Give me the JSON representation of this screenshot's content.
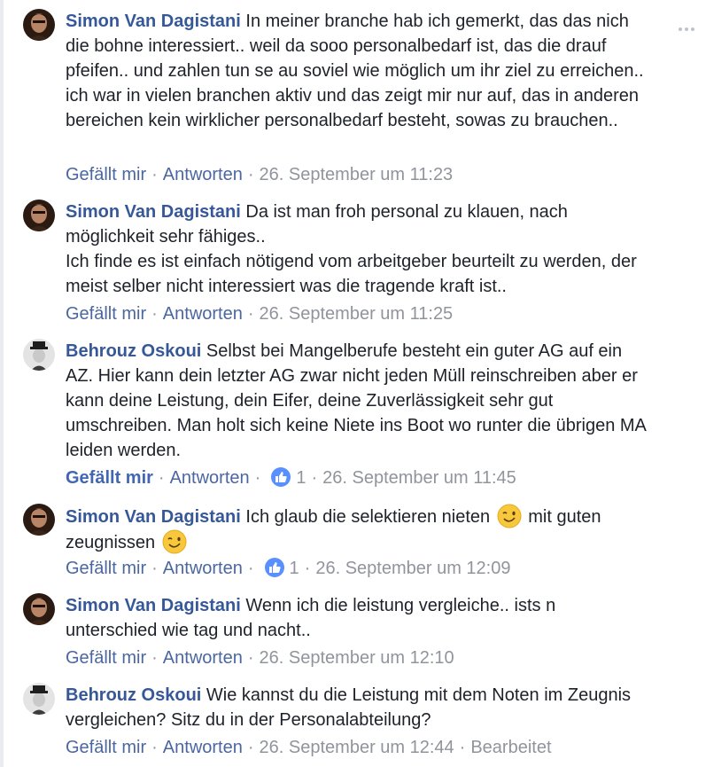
{
  "comments": [
    {
      "author": "Simon Van Dagistani",
      "avatar_type": "simon",
      "text": "In meiner branche hab ich gemerkt, das das nich die bohne interessiert.. weil da sooo personalbedarf ist, das die drauf pfeifen.. und zahlen tun se au soviel wie möglich um ihr ziel zu erreichen.. ich war in vielen branchen aktiv und das zeigt mir nur auf, das in anderen bereichen kein wirklicher personalbedarf besteht, sowas zu brauchen..",
      "like_label": "Gefällt mir",
      "reply_label": "Antworten",
      "time": "26. September um 11:23"
    },
    {
      "author": "Simon Van Dagistani",
      "avatar_type": "simon",
      "text_lines": [
        "Da ist man froh personal zu klauen, nach möglichkeit sehr fähiges..",
        "Ich finde es ist einfach nötigend vom arbeitgeber beurteilt zu werden, der meist selber nicht interessiert was die tragende kraft ist.."
      ],
      "like_label": "Gefällt mir",
      "reply_label": "Antworten",
      "time": "26. September um 11:25"
    },
    {
      "author": "Behrouz Oskoui",
      "avatar_type": "behrouz",
      "text": "Selbst bei Mangelberufe besteht ein guter AG auf ein AZ. Hier kann dein letzter AG zwar nicht jeden Müll reinschreiben aber er kann deine Leistung, dein Eifer, deine Zuverlässigkeit sehr gut umschreiben. Man holt sich keine Niete ins Boot wo runter die übrigen MA leiden werden.",
      "like_label": "Gefällt mir",
      "reply_label": "Antworten",
      "like_count": "1",
      "time": "26. September um 11:45"
    },
    {
      "author": "Simon Van Dagistani",
      "avatar_type": "simon",
      "text_a": "Ich glaub die selektieren nieten",
      "text_b": "mit guten zeugnissen",
      "emoji": "wink-emoji",
      "like_label": "Gefällt mir",
      "reply_label": "Antworten",
      "like_count": "1",
      "time": "26. September um 12:09"
    },
    {
      "author": "Simon Van Dagistani",
      "avatar_type": "simon",
      "text": "Wenn ich die leistung vergleiche.. ists n unterschied wie tag und nacht..",
      "like_label": "Gefällt mir",
      "reply_label": "Antworten",
      "time": "26. September um 12:10"
    },
    {
      "author": "Behrouz Oskoui",
      "avatar_type": "behrouz",
      "text": "Wie kannst du die Leistung mit dem Noten im Zeugnis vergleichen? Sitz du in der Personalabteilung?",
      "like_label": "Gefällt mir",
      "reply_label": "Antworten",
      "time": "26. September um 12:44",
      "edited_label": "Bearbeitet"
    }
  ],
  "icons": {
    "more": "more-options-icon",
    "like": "thumbs-up-icon",
    "emoji": "wink-emoji"
  },
  "colors": {
    "author": "#365899",
    "link": "#4b67a1",
    "muted": "#90949c",
    "like_badge": "#5890ff",
    "text": "#1d2129"
  }
}
